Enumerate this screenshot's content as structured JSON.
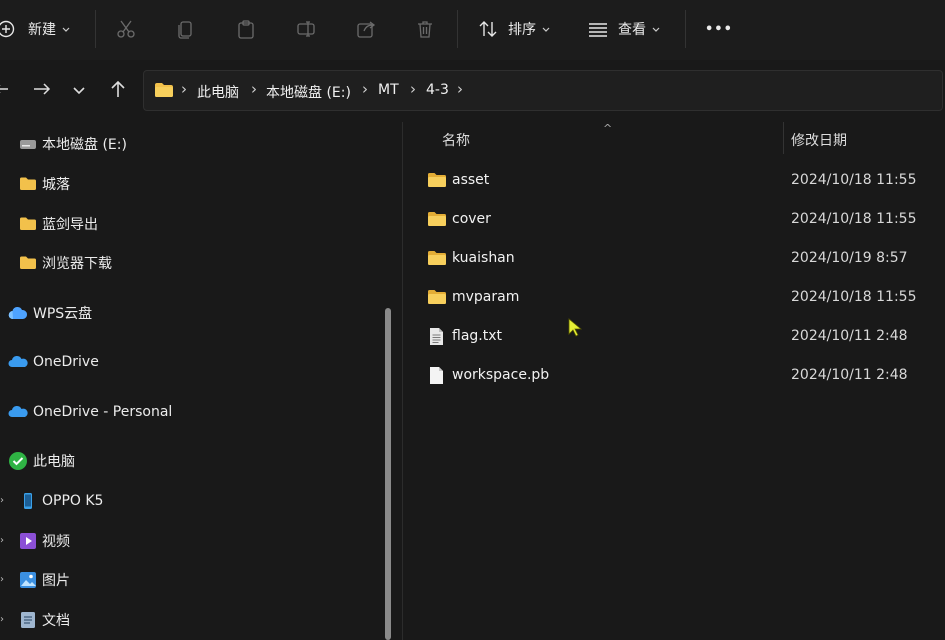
{
  "toolbar": {
    "new_label": "新建",
    "sort_label": "排序",
    "view_label": "查看",
    "more_label": "•••"
  },
  "address": {
    "crumbs": [
      "此电脑",
      "本地磁盘 (E:)",
      "MT",
      "4-3"
    ]
  },
  "sidebar": {
    "items": [
      {
        "label": "本地磁盘 (E:)",
        "icon": "drive-icon"
      },
      {
        "label": "城落",
        "icon": "folder-icon"
      },
      {
        "label": "蓝剑导出",
        "icon": "folder-icon"
      },
      {
        "label": "浏览器下载",
        "icon": "folder-icon"
      },
      {
        "label": "WPS云盘",
        "icon": "cloud-icon"
      },
      {
        "label": "OneDrive",
        "icon": "onedrive-icon"
      },
      {
        "label": "OneDrive - Personal",
        "icon": "onedrive-icon"
      },
      {
        "label": "此电脑",
        "icon": "check-circle-icon"
      },
      {
        "label": "OPPO K5",
        "icon": "phone-icon"
      },
      {
        "label": "视频",
        "icon": "video-icon"
      },
      {
        "label": "图片",
        "icon": "picture-icon"
      },
      {
        "label": "文档",
        "icon": "document-icon"
      }
    ]
  },
  "filelist": {
    "headers": {
      "name": "名称",
      "modified": "修改日期"
    },
    "files": [
      {
        "name": "asset",
        "date": "2024/10/18 11:55",
        "type": "folder"
      },
      {
        "name": "cover",
        "date": "2024/10/18 11:55",
        "type": "folder"
      },
      {
        "name": "kuaishan",
        "date": "2024/10/19 8:57",
        "type": "folder"
      },
      {
        "name": "mvparam",
        "date": "2024/10/18 11:55",
        "type": "folder"
      },
      {
        "name": "flag.txt",
        "date": "2024/10/11 2:48",
        "type": "text"
      },
      {
        "name": "workspace.pb",
        "date": "2024/10/11 2:48",
        "type": "file"
      }
    ]
  },
  "colors": {
    "background": "#191919",
    "folder": "#f2c14b",
    "accent": "#4ea3ff"
  }
}
